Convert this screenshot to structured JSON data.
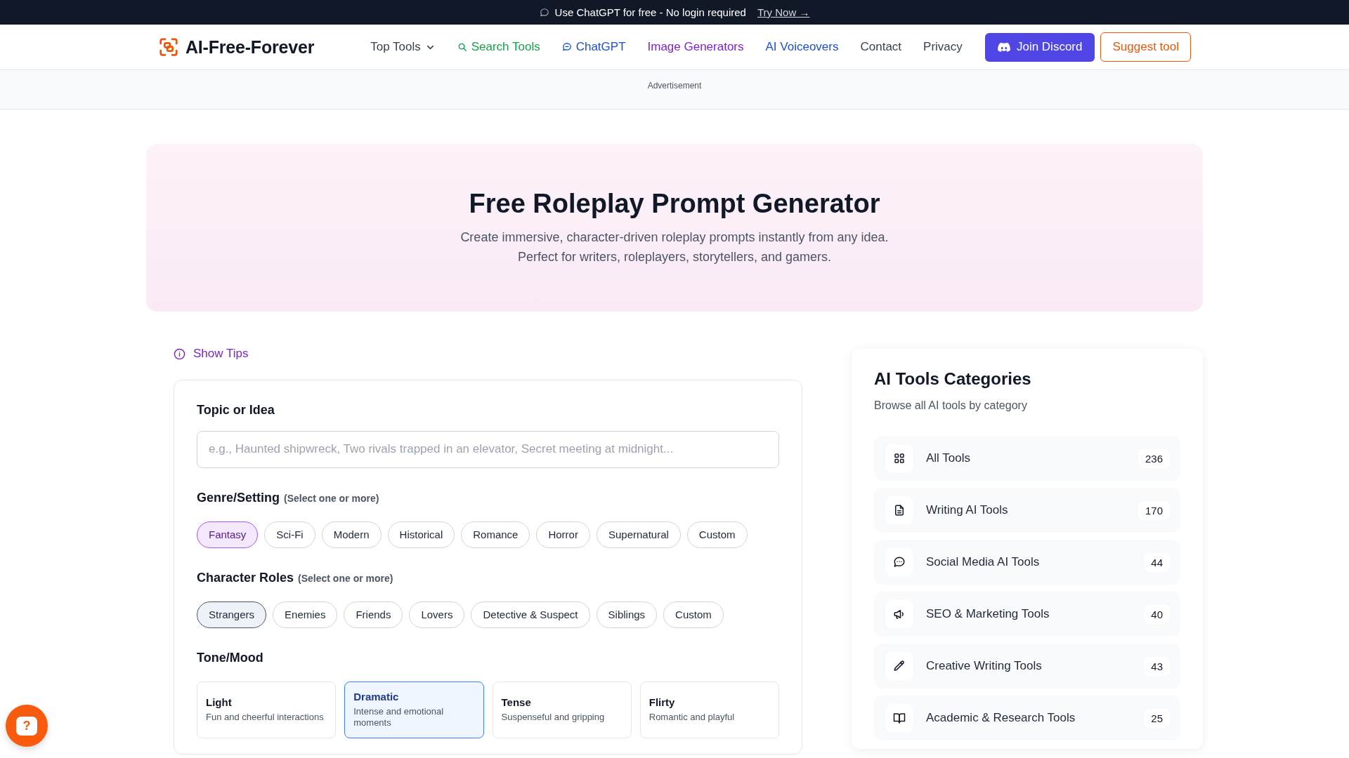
{
  "announcement": {
    "text": "Use ChatGPT for free - No login required",
    "link": "Try Now →"
  },
  "header": {
    "logo": "AI-Free-Forever",
    "nav": [
      {
        "label": "Top Tools",
        "kind": "dropdown",
        "color": "#374151"
      },
      {
        "label": "Search Tools",
        "kind": "search",
        "color": "#16a34a"
      },
      {
        "label": "ChatGPT",
        "kind": "chat",
        "color": "#1d4ed8"
      },
      {
        "label": "Image Generators",
        "kind": "plain",
        "color": "#7e22ce"
      },
      {
        "label": "AI Voiceovers",
        "kind": "plain",
        "color": "#1d4ed8"
      },
      {
        "label": "Contact",
        "kind": "plain",
        "color": "#374151"
      },
      {
        "label": "Privacy",
        "kind": "plain",
        "color": "#374151"
      }
    ],
    "buttons": [
      {
        "label": "Join Discord",
        "kind": "primary"
      },
      {
        "label": "Suggest tool",
        "kind": "outline"
      }
    ]
  },
  "ad_banner": {
    "label": "Advertisement"
  },
  "hero": {
    "title": "Free Roleplay Prompt Generator",
    "subtitle": [
      "Create immersive, character-driven roleplay prompts instantly from any idea.",
      "Perfect for writers, roleplayers, storytellers, and gamers."
    ]
  },
  "tips_toggle": {
    "label": "Show Tips"
  },
  "form": {
    "topic": {
      "label": "Topic or Idea",
      "placeholder": "e.g., Haunted shipwreck, Two rivals trapped in an elevator, Secret meeting at midnight..."
    },
    "genre": {
      "label": "Genre/Setting",
      "hint": "(Select one or more)",
      "options": [
        {
          "label": "Fantasy",
          "selected": true
        },
        {
          "label": "Sci-Fi",
          "selected": false
        },
        {
          "label": "Modern",
          "selected": false
        },
        {
          "label": "Historical",
          "selected": false
        },
        {
          "label": "Romance",
          "selected": false
        },
        {
          "label": "Horror",
          "selected": false
        },
        {
          "label": "Supernatural",
          "selected": false
        },
        {
          "label": "Custom",
          "selected": false
        }
      ]
    },
    "roles": {
      "label": "Character Roles",
      "hint": "(Select one or more)",
      "options": [
        {
          "label": "Strangers",
          "selected": true
        },
        {
          "label": "Enemies",
          "selected": false
        },
        {
          "label": "Friends",
          "selected": false
        },
        {
          "label": "Lovers",
          "selected": false
        },
        {
          "label": "Detective & Suspect",
          "selected": false
        },
        {
          "label": "Siblings",
          "selected": false
        },
        {
          "label": "Custom",
          "selected": false
        }
      ]
    },
    "tone": {
      "label": "Tone/Mood",
      "options": [
        {
          "title": "Light",
          "description": "Fun and cheerful interactions",
          "selected": false
        },
        {
          "title": "Dramatic",
          "description": "Intense and emotional moments",
          "selected": true
        },
        {
          "title": "Tense",
          "description": "Suspenseful and gripping",
          "selected": false
        },
        {
          "title": "Flirty",
          "description": "Romantic and playful",
          "selected": false
        }
      ]
    }
  },
  "sidebar": {
    "title": "AI Tools Categories",
    "subtitle": "Browse all AI tools by category",
    "categories": [
      {
        "label": "All Tools",
        "count": "236",
        "kind": "grid"
      },
      {
        "label": "Writing AI Tools",
        "count": "170",
        "kind": "document"
      },
      {
        "label": "Social Media AI Tools",
        "count": "44",
        "kind": "chat"
      },
      {
        "label": "SEO & Marketing Tools",
        "count": "40",
        "kind": "megaphone"
      },
      {
        "label": "Creative Writing Tools",
        "count": "43",
        "kind": "pencil"
      },
      {
        "label": "Academic & Research Tools",
        "count": "25",
        "kind": "book"
      }
    ]
  },
  "help_button": {
    "glyph": "?"
  }
}
